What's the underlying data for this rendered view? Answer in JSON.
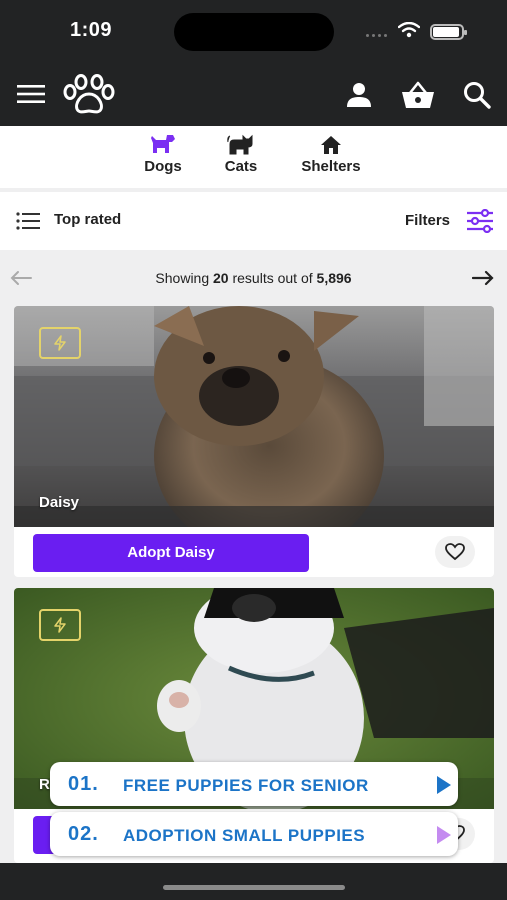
{
  "status_bar": {
    "time": "1:09"
  },
  "categories": [
    {
      "label": "Dogs",
      "icon": "dog-icon",
      "active": true
    },
    {
      "label": "Cats",
      "icon": "cat-icon",
      "active": false
    },
    {
      "label": "Shelters",
      "icon": "house-icon",
      "active": false
    }
  ],
  "sort": {
    "label": "Top rated"
  },
  "filters": {
    "label": "Filters"
  },
  "pager": {
    "prefix": "Showing",
    "shown": "20",
    "middle": "results out of",
    "total": "5,896"
  },
  "pets": [
    {
      "name": "Daisy",
      "adopt_label": "Adopt Daisy"
    },
    {
      "name": "R",
      "adopt_label": ""
    }
  ],
  "ads": [
    {
      "number": "01.",
      "text": "FREE PUPPIES FOR SENIOR"
    },
    {
      "number": "02.",
      "text": "ADOPTION SMALL PUPPIES"
    }
  ],
  "colors": {
    "accent": "#6a1ef1",
    "bar": "#222324",
    "ad_text": "#1c74c7"
  }
}
